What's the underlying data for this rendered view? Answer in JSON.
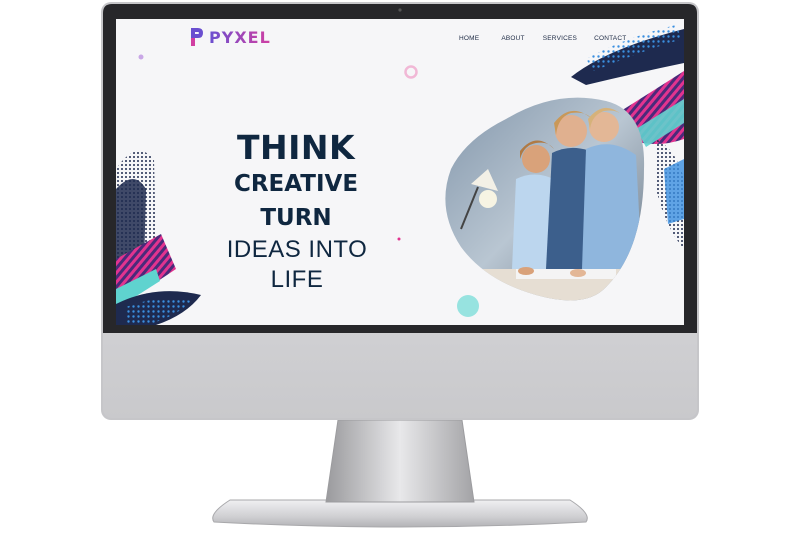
{
  "brand": {
    "name": "PYXEL",
    "gradient": [
      "#6a4fd0",
      "#d13fa2"
    ]
  },
  "nav": {
    "items": [
      {
        "label": "HOME"
      },
      {
        "label": "ABOUT"
      },
      {
        "label": "SERVICES"
      },
      {
        "label": "CONTACT"
      }
    ]
  },
  "hero": {
    "line1": "THINK",
    "line2": "CREATIVE",
    "line3": "TURN",
    "line4": "IDEAS INTO LIFE"
  },
  "colors": {
    "heading": "#0f2740",
    "accent_pink": "#e2338f",
    "accent_navy": "#1e2a4f",
    "accent_teal": "#5fd3cf",
    "accent_blue": "#3a8fe0",
    "screen_bg": "#f6f6f8",
    "bezel": "#2b2b2e",
    "chassis": "#d4d4d6"
  },
  "photo": {
    "description_icon": "team-working-photo"
  }
}
